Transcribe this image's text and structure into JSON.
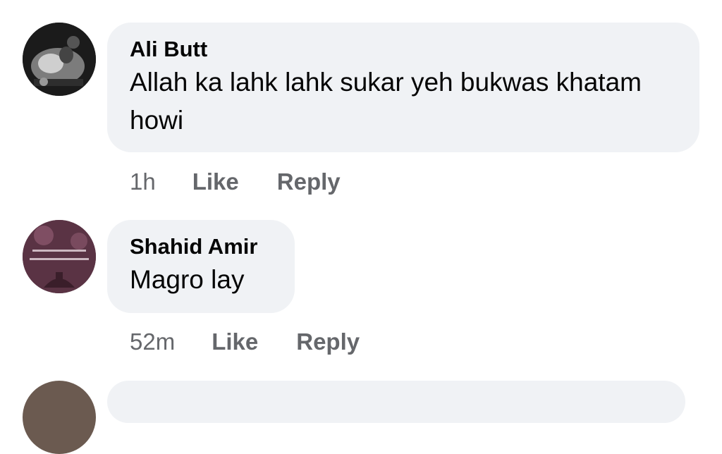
{
  "comments": [
    {
      "author": "Ali Butt",
      "text": "Allah ka lahk lahk sukar yeh bukwas khatam howi",
      "time": "1h",
      "like_label": "Like",
      "reply_label": "Reply"
    },
    {
      "author": "Shahid Amir",
      "text": "Magro lay",
      "time": "52m",
      "like_label": "Like",
      "reply_label": "Reply"
    }
  ],
  "colors": {
    "bubble_bg": "#f0f2f5",
    "text": "#050505",
    "meta": "#65676b"
  }
}
